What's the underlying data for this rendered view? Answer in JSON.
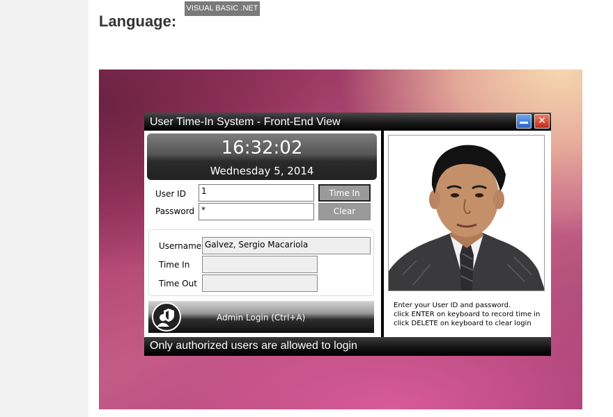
{
  "page": {
    "language_label": "Language:",
    "language_tag": "VISUAL BASIC .NET"
  },
  "app": {
    "title": "User Time-In System - Front-End View",
    "close_glyph": "✕",
    "clock": {
      "time": "16:32:02",
      "date": "Wednesday 5, 2014"
    },
    "login": {
      "user_id_label": "User ID",
      "user_id_value": "1",
      "password_label": "Password",
      "password_value": "*",
      "time_in_button": "Time In",
      "clear_button": "Clear"
    },
    "info": {
      "username_label": "Username",
      "username_value": "Galvez, Sergio Macariola",
      "time_in_label": "Time In",
      "time_in_value": "",
      "time_out_label": "Time Out",
      "time_out_value": ""
    },
    "admin_button": "Admin Login (Ctrl+A)",
    "instructions": [
      "Enter your User ID and password.",
      "click ENTER on keyboard to record time in",
      "click DELETE on keyboard to clear login"
    ],
    "footer": "Only authorized users are allowed to login"
  },
  "icons": {
    "minimize": "minimize-icon",
    "close": "close-icon",
    "admin": "admin-shield-user-icon"
  },
  "colors": {
    "titlebar": "#000000",
    "button_gray": "#9a9a9a",
    "minimize": "#2a63c4",
    "close": "#c0281e"
  }
}
